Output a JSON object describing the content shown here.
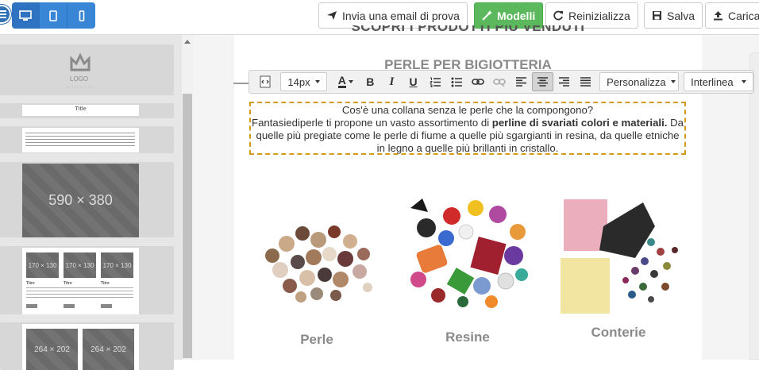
{
  "toolbar": {
    "send_email": "Invia una email di prova",
    "models": "Modelli",
    "reset": "Reinizializza",
    "save": "Salva",
    "load": "Carica"
  },
  "sidebar": {
    "logo_text": "LOGO",
    "title_block": "Title",
    "image_placeholder": "590 × 380",
    "three_col_placeholder": "170 × 130",
    "three_col_title": "Titre",
    "two_col_placeholder": "264 × 202"
  },
  "email": {
    "heading_partial": "SCOPRI I PRODOTTI PIÙ VENDUTI",
    "section_title": "PERLE PER BIGIOTTERIA",
    "paragraph": {
      "line1": "Cos'è una collana senza le perle che la compongono?",
      "line2_before": "Fantasiediperle ti propone un vasto assortimento di ",
      "line2_bold": "perline di svariati colori e materiali.",
      "line2_after": " Da quelle più pregiate come le perle di fiume a quelle più sgargianti in resina, da quelle etniche in legno a quelle più brillanti in cristallo."
    },
    "products": [
      {
        "name": "Perle"
      },
      {
        "name": "Resine"
      },
      {
        "name": "Conterie"
      }
    ]
  },
  "editor": {
    "font_size": "14px",
    "custom_label": "Personalizza",
    "line_height_label": "Interlinea"
  },
  "colors": {
    "device_blue": "#3a86d6",
    "models_green": "#5cb85c",
    "selection_border": "#d49a1c"
  }
}
